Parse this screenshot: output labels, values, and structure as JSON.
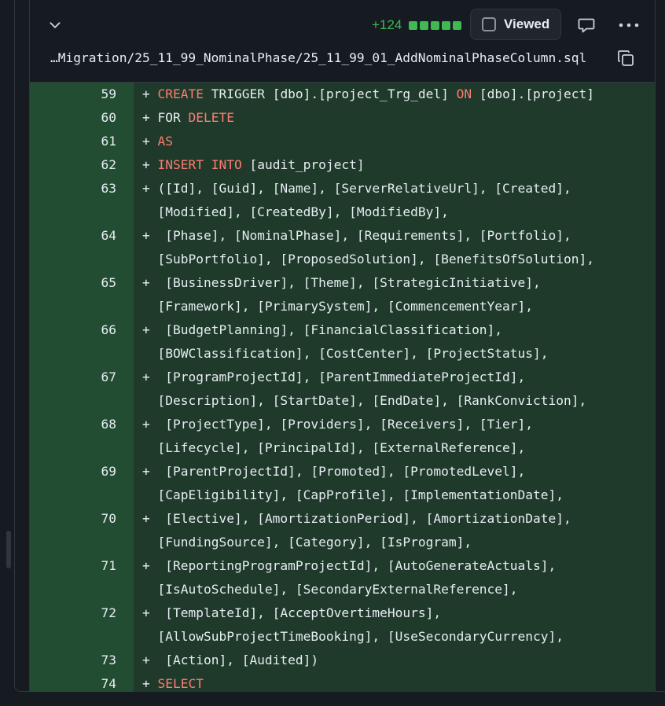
{
  "header": {
    "additions": "+124",
    "viewed_label": "Viewed",
    "file_path": "…Migration/25_11_99_NominalPhase/25_11_99_01_AddNominalPhaseColumn.sql"
  },
  "icons": {
    "collapse": "chevron-down-icon",
    "comment": "comment-icon",
    "more": "kebab-horizontal-icon",
    "copy": "copy-icon"
  },
  "colors": {
    "added_line_bg": "#1f3a2a",
    "added_gutter_bg": "#234d33",
    "keyword": "#ff7b72",
    "additions": "#3fb950"
  },
  "diff": {
    "lines": [
      {
        "num": "59",
        "segments": [
          [
            "+ ",
            ""
          ],
          [
            "CREATE",
            "kw"
          ],
          [
            " TRIGGER [dbo].[project_Trg_del] ",
            ""
          ],
          [
            "ON",
            "kw"
          ],
          [
            " [dbo].[project]",
            ""
          ]
        ]
      },
      {
        "num": "60",
        "segments": [
          [
            "+ FOR ",
            ""
          ],
          [
            "DELETE",
            "kw"
          ]
        ]
      },
      {
        "num": "61",
        "segments": [
          [
            "+ ",
            ""
          ],
          [
            "AS",
            "kw"
          ]
        ]
      },
      {
        "num": "62",
        "segments": [
          [
            "+ ",
            ""
          ],
          [
            "INSERT",
            "kw"
          ],
          [
            " ",
            ""
          ],
          [
            "INTO",
            "kw"
          ],
          [
            " [audit_project]",
            ""
          ]
        ]
      },
      {
        "num": "63",
        "segments": [
          [
            "+ ([Id], [Guid], [Name], [ServerRelativeUrl], [Created],",
            ""
          ]
        ]
      },
      {
        "num": "",
        "segments": [
          [
            "  [Modified], [CreatedBy], [ModifiedBy],",
            ""
          ]
        ]
      },
      {
        "num": "64",
        "segments": [
          [
            "+  [Phase], [NominalPhase], [Requirements], [Portfolio],",
            ""
          ]
        ]
      },
      {
        "num": "",
        "segments": [
          [
            "  [SubPortfolio], [ProposedSolution], [BenefitsOfSolution],",
            ""
          ]
        ]
      },
      {
        "num": "65",
        "segments": [
          [
            "+  [BusinessDriver], [Theme], [StrategicInitiative],",
            ""
          ]
        ]
      },
      {
        "num": "",
        "segments": [
          [
            "  [Framework], [PrimarySystem], [CommencementYear],",
            ""
          ]
        ]
      },
      {
        "num": "66",
        "segments": [
          [
            "+  [BudgetPlanning], [FinancialClassification],",
            ""
          ]
        ]
      },
      {
        "num": "",
        "segments": [
          [
            "  [BOWClassification], [CostCenter], [ProjectStatus],",
            ""
          ]
        ]
      },
      {
        "num": "67",
        "segments": [
          [
            "+  [ProgramProjectId], [ParentImmediateProjectId],",
            ""
          ]
        ]
      },
      {
        "num": "",
        "segments": [
          [
            "  [Description], [StartDate], [EndDate], [RankConviction],",
            ""
          ]
        ]
      },
      {
        "num": "68",
        "segments": [
          [
            "+  [ProjectType], [Providers], [Receivers], [Tier],",
            ""
          ]
        ]
      },
      {
        "num": "",
        "segments": [
          [
            "  [Lifecycle], [PrincipalId], [ExternalReference],",
            ""
          ]
        ]
      },
      {
        "num": "69",
        "segments": [
          [
            "+  [ParentProjectId], [Promoted], [PromotedLevel],",
            ""
          ]
        ]
      },
      {
        "num": "",
        "segments": [
          [
            "  [CapEligibility], [CapProfile], [ImplementationDate],",
            ""
          ]
        ]
      },
      {
        "num": "70",
        "segments": [
          [
            "+  [Elective], [AmortizationPeriod], [AmortizationDate],",
            ""
          ]
        ]
      },
      {
        "num": "",
        "segments": [
          [
            "  [FundingSource], [Category], [IsProgram],",
            ""
          ]
        ]
      },
      {
        "num": "71",
        "segments": [
          [
            "+  [ReportingProgramProjectId], [AutoGenerateActuals],",
            ""
          ]
        ]
      },
      {
        "num": "",
        "segments": [
          [
            "  [IsAutoSchedule], [SecondaryExternalReference],",
            ""
          ]
        ]
      },
      {
        "num": "72",
        "segments": [
          [
            "+  [TemplateId], [AcceptOvertimeHours],",
            ""
          ]
        ]
      },
      {
        "num": "",
        "segments": [
          [
            "  [AllowSubProjectTimeBooking], [UseSecondaryCurrency],",
            ""
          ]
        ]
      },
      {
        "num": "73",
        "segments": [
          [
            "+  [Action], [Audited])",
            ""
          ]
        ]
      },
      {
        "num": "74",
        "segments": [
          [
            "+ ",
            ""
          ],
          [
            "SELECT",
            "kw"
          ]
        ]
      }
    ]
  }
}
